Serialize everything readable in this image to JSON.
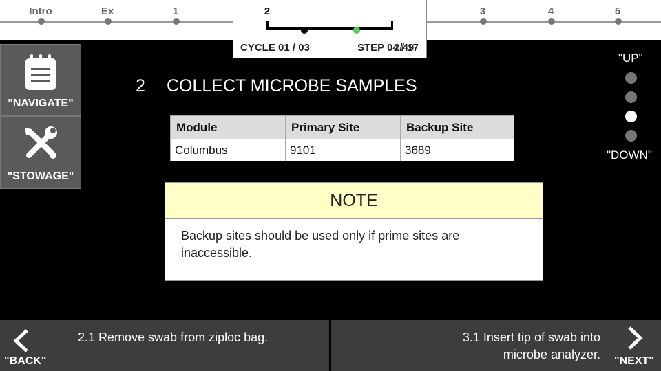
{
  "progress": {
    "stages": [
      {
        "label": "Intro",
        "current": false
      },
      {
        "label": "Ex",
        "current": false
      },
      {
        "label": "1",
        "current": false
      },
      {
        "label": "2",
        "current": true
      },
      {
        "label": "3",
        "current": false
      },
      {
        "label": "4",
        "current": false
      },
      {
        "label": "5",
        "current": false
      }
    ],
    "cycle_text": "CYCLE 01 / 03",
    "step_text": "STEP 04 / 17",
    "step_overlay_text": "2/49",
    "colors": {
      "active_dot": "#5cc85c",
      "done_dot": "#000000"
    }
  },
  "side_buttons": {
    "navigate": {
      "label": "\"NAVIGATE\"",
      "icon": "clipboard-icon"
    },
    "stowage": {
      "label": "\"STOWAGE\"",
      "icon": "wrench-screwdriver-icon"
    }
  },
  "step": {
    "number": "2",
    "title": "COLLECT MICROBE SAMPLES"
  },
  "table": {
    "headers": [
      "Module",
      "Primary Site",
      "Backup Site"
    ],
    "rows": [
      [
        "Columbus",
        "9101",
        "3689"
      ]
    ]
  },
  "note": {
    "title": "NOTE",
    "body": "Backup sites should be used only if prime sites are inaccessible.",
    "header_color": "#ffffc6"
  },
  "scroll": {
    "up_label": "\"UP\"",
    "down_label": "\"DOWN\"",
    "dot_count": 4,
    "active_index": 2
  },
  "bottom_nav": {
    "back": {
      "label": "\"BACK\"",
      "text": "2.1 Remove swab from ziploc bag."
    },
    "next": {
      "label": "\"NEXT\"",
      "text_line1": "3.1 Insert tip of swab into",
      "text_line2": "microbe analyzer."
    }
  }
}
